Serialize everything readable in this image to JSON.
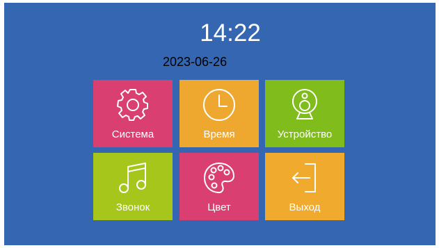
{
  "status": {
    "time": "14:22",
    "date": "2023-06-26"
  },
  "menu": {
    "items": [
      {
        "label": "Система",
        "icon": "gear-icon",
        "color": "#da3f72"
      },
      {
        "label": "Время",
        "icon": "clock-icon",
        "color": "#eea72f"
      },
      {
        "label": "Устройство",
        "icon": "webcam-icon",
        "color": "#80bc1c"
      },
      {
        "label": "Звонок",
        "icon": "music-note-icon",
        "color": "#a7c61c"
      },
      {
        "label": "Цвет",
        "icon": "palette-icon",
        "color": "#da3f72"
      },
      {
        "label": "Выход",
        "icon": "exit-icon",
        "color": "#f0aa2e"
      }
    ]
  },
  "colors": {
    "background": "#3566b2",
    "text": "#ffffff"
  }
}
